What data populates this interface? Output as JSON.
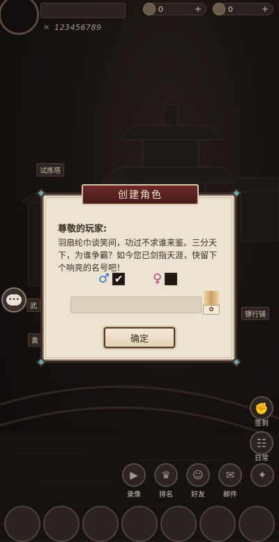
{
  "header": {
    "uid": "123456789",
    "currency_1": {
      "icon": "coin-icon",
      "value": "0",
      "add": "+"
    },
    "currency_2": {
      "icon": "gem-icon",
      "value": "0",
      "add": "+"
    }
  },
  "map_labels": {
    "tower": "试炼塔",
    "left_label": "武",
    "left_label_2": "黄",
    "right_label": "镖行铺"
  },
  "dialog": {
    "title": "创建角色",
    "greeting": "尊敬的玩家:",
    "message": "羽扇纶巾谈笑间，功过不求谁来鉴。三分天下，为谁争霸？如今您已剑指天涯，快留下个响亮的名号吧！",
    "male_symbol": "♂",
    "male_checked": "✔",
    "female_symbol": "♀",
    "name_value": "",
    "random_button_icon": "dice-icon",
    "random_label": "✿",
    "confirm_label": "确定"
  },
  "side": {
    "chat_label": "•••",
    "top_right_label": "签到",
    "daily_label": "日常"
  },
  "bottom_nav": [
    {
      "label": "录像",
      "icon": "video-icon",
      "glyph": "▶"
    },
    {
      "label": "排名",
      "icon": "trophy-icon",
      "glyph": "♛"
    },
    {
      "label": "好友",
      "icon": "friends-icon",
      "glyph": "☺"
    },
    {
      "label": "邮件",
      "icon": "mail-icon",
      "glyph": "✉"
    },
    {
      "label": "",
      "icon": "compass-icon",
      "glyph": "✦"
    }
  ],
  "colors": {
    "dialog_bg": "#ece3d2",
    "title_plate": "#6b2a2a",
    "accent": "#6aa7a8"
  }
}
